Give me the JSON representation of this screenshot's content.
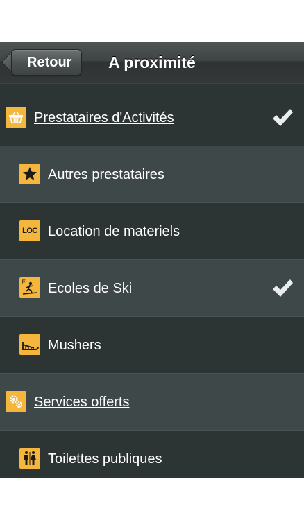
{
  "navbar": {
    "back_label": "Retour",
    "title": "A proximité"
  },
  "list": {
    "items": [
      {
        "label": "Prestataires d'Activités",
        "icon": "basket-icon",
        "checked": true
      },
      {
        "label": "Autres prestataires",
        "icon": "star-icon",
        "checked": false
      },
      {
        "label": "Location de materiels",
        "icon": "loc-icon",
        "icon_text": "LOC",
        "checked": false
      },
      {
        "label": "Ecoles de Ski",
        "icon": "skier-icon",
        "icon_text": "E",
        "checked": true
      },
      {
        "label": "Mushers",
        "icon": "dog-sled-icon",
        "checked": false
      },
      {
        "label": "Services offerts",
        "icon": "gears-icon",
        "checked": false
      },
      {
        "label": "Toilettes publiques",
        "icon": "toilets-icon",
        "checked": false
      }
    ]
  },
  "colors": {
    "accent_icon": "#f5b63d",
    "row_dark": "#2c3434",
    "row_light": "#3e4848"
  }
}
